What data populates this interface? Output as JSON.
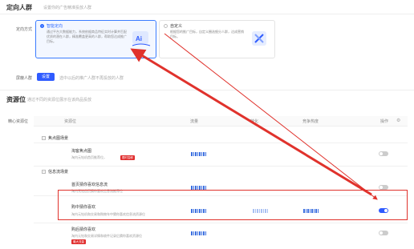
{
  "targeting": {
    "title": "定向人群",
    "subtitle": "设置你的广告精准投放人群",
    "mode_label": "定向方式",
    "options": [
      {
        "title": "智能定向",
        "desc": "通过平台大数据能力，系统依据商品特征实时计算并匹配优质的潜在人群，精准覆盖更高的人群，帮助您达成推广目标。",
        "selected": true
      },
      {
        "title": "自定义",
        "desc": "根据您的推广目标，自定义圈选细分人群，达成营销目标。",
        "selected": false
      }
    ],
    "crowd_label": "屏蔽人群",
    "crowd_button": "设置",
    "crowd_hint": "选中以后的推广人群不再投放的人群"
  },
  "resource": {
    "title": "资源位",
    "subtitle": "通过不同的资源位展示在该商品投放",
    "side_label": "精心资源位",
    "headers": [
      "资源位",
      "流量",
      "转化",
      "竞争热度",
      "操作"
    ],
    "groups": [
      {
        "name": "焦点图场景",
        "rows": [
          {
            "name": "淘客焦点图",
            "desc": "淘内元钻机首页推荐位，",
            "badge": "限时尝鲜",
            "on": false
          }
        ]
      },
      {
        "name": "信息流场景",
        "rows": [
          {
            "name": "首页猜你喜欢信息流",
            "desc": "淘内元钻首页猜你喜欢信息流推荐位",
            "badge": "",
            "on": false
          },
          {
            "name": "购中猜你喜欢",
            "desc": "淘内元钻机和交易和购物车中猜你喜欢信息流资源位",
            "badge": "",
            "on": true
          },
          {
            "name": "购后猜你喜欢",
            "desc": "淘内元钻和交易详情和收件记录后猜你喜欢资源位",
            "badge": "最大流量",
            "on": false
          }
        ]
      }
    ]
  },
  "colors": {
    "accent": "#2f5bff",
    "highlight": "#e0322c",
    "badge": "#e02b2b"
  }
}
